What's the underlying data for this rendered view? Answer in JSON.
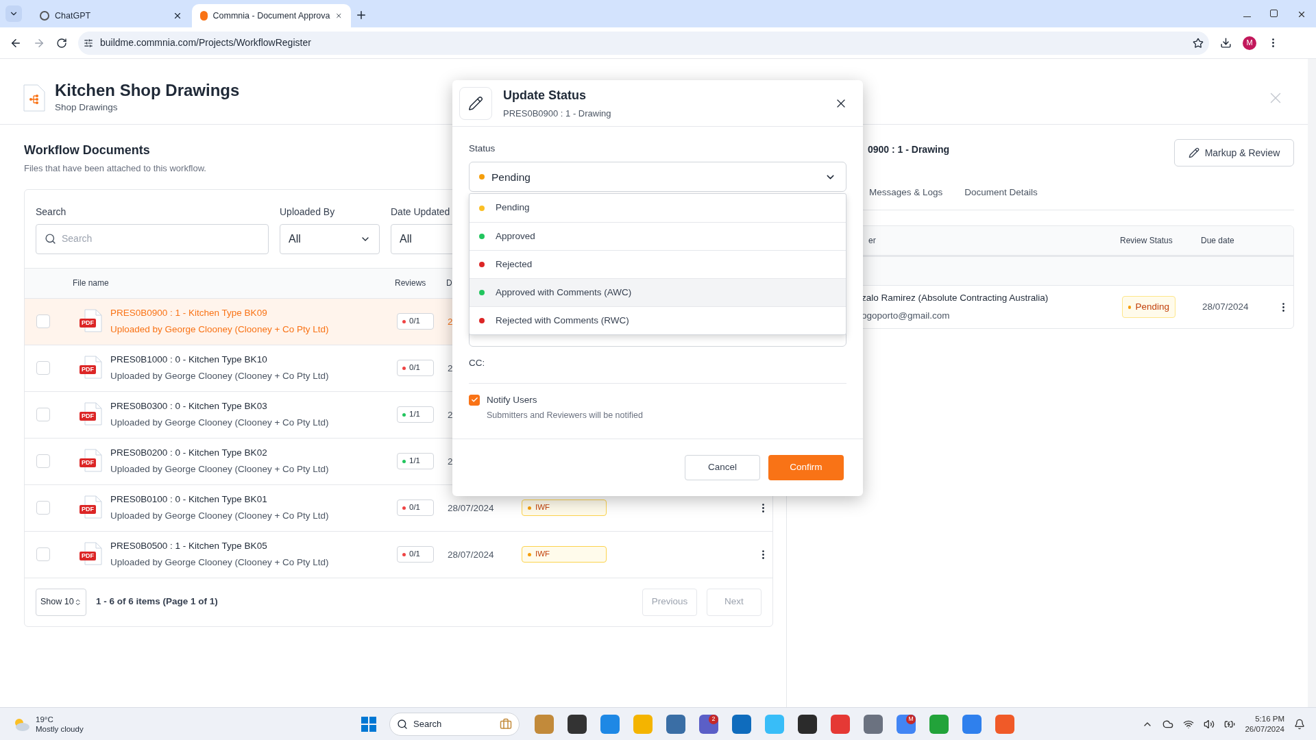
{
  "browser": {
    "tabs": [
      {
        "title": "ChatGPT",
        "selected": false
      },
      {
        "title": "Commnia - Document Approva",
        "selected": true
      }
    ],
    "url": "buildme.commnia.com/Projects/WorkflowRegister",
    "profile": "M"
  },
  "header": {
    "title": "Kitchen Shop Drawings",
    "subtitle": "Shop Drawings"
  },
  "documents": {
    "title": "Workflow Documents",
    "subtitle": "Files that have been attached to this workflow.",
    "filters": {
      "search_label": "Search",
      "search_placeholder": "Search",
      "uploaded_by_label": "Uploaded By",
      "uploaded_by_value": "All",
      "date_updated_label": "Date Updated",
      "date_updated_value": "All"
    },
    "columns": [
      "File name",
      "Reviews",
      "D"
    ],
    "rows": [
      {
        "name": "PRES0B0900 : 1 - Kitchen Type BK09",
        "uploader": "Uploaded by George Clooney (Clooney + Co Pty Ltd)",
        "file_type": "PDF",
        "reviews": "0/1",
        "color": "#ef4444",
        "date": "2",
        "selected": true,
        "checked": false
      },
      {
        "name": "PRES0B1000 : 0 - Kitchen Type BK10",
        "uploader": "Uploaded by George Clooney (Clooney + Co Pty Ltd)",
        "file_type": "PDF",
        "reviews": "0/1",
        "color": "#ef4444",
        "date": "2",
        "selected": false,
        "checked": false
      },
      {
        "name": "PRES0B0300 : 0 - Kitchen Type BK03",
        "uploader": "Uploaded by George Clooney (Clooney + Co Pty Ltd)",
        "file_type": "PDF",
        "reviews": "1/1",
        "color": "#22c55e",
        "date": "2",
        "selected": false,
        "checked": false
      },
      {
        "name": "PRES0B0200 : 0 - Kitchen Type BK02",
        "uploader": "Uploaded by George Clooney (Clooney + Co Pty Ltd)",
        "file_type": "PDF",
        "reviews": "1/1",
        "color": "#22c55e",
        "date": "2",
        "selected": false,
        "checked": false
      },
      {
        "name": "PRES0B0100 : 0 - Kitchen Type BK01",
        "uploader": "Uploaded by George Clooney (Clooney + Co Pty Ltd)",
        "file_type": "PDF",
        "reviews": "0/1",
        "color": "#ef4444",
        "date": "28/07/2024",
        "status": "IWF",
        "selected": false,
        "checked": false
      },
      {
        "name": "PRES0B0500 : 1 - Kitchen Type BK05",
        "uploader": "Uploaded by George Clooney (Clooney + Co Pty Ltd)",
        "file_type": "PDF",
        "reviews": "0/1",
        "color": "#ef4444",
        "date": "28/07/2024",
        "status": "IWF",
        "selected": false,
        "checked": false
      }
    ],
    "footer": {
      "page_size": "Show 10",
      "summary": "1 - 6 of 6 items (Page 1 of 1)",
      "previous": "Previous",
      "next": "Next"
    }
  },
  "details": {
    "document_title": "0900 : 1 - Drawing",
    "markup_button": "Markup & Review",
    "tabs": [
      {
        "label": "Messages & Logs",
        "selected": false
      },
      {
        "label": "Document Details",
        "selected": false
      }
    ],
    "columns": [
      "er",
      "Review Status",
      "Due date"
    ],
    "rows": [
      {
        "name": "zalo Ramirez (Absolute Contracting Australia)",
        "email": "ogoporto@gmail.com",
        "status": "Pending",
        "due": "28/07/2024"
      }
    ]
  },
  "modal": {
    "title": "Update Status",
    "subtitle": "PRES0B0900 : 1 - Drawing",
    "status_label": "Status",
    "status": {
      "label": "Pending",
      "color": "#f59e0b"
    },
    "options": [
      {
        "label": "Pending",
        "color": "#fbbf24",
        "highlighted": false
      },
      {
        "label": "Approved",
        "color": "#22c55e",
        "highlighted": false
      },
      {
        "label": "Rejected",
        "color": "#dc2626",
        "highlighted": false
      },
      {
        "label": "Approved with Comments (AWC)",
        "color": "#22c55e",
        "highlighted": true
      },
      {
        "label": "Rejected with Comments (RWC)",
        "color": "#dc2626",
        "highlighted": false
      }
    ],
    "cc_label": "CC:",
    "notify": {
      "label": "Notify Users",
      "description": "Submitters and Reviewers will be notified",
      "checked": true
    },
    "cancel": "Cancel",
    "confirm": "Confirm"
  },
  "taskbar": {
    "temperature": "19°C",
    "weather": "Mostly cloudy",
    "search": "Search",
    "apps": [
      {
        "color": "#c28a3a"
      },
      {
        "color": "#333333"
      },
      {
        "color": "#1e88e5"
      },
      {
        "color": "#f4b400"
      },
      {
        "color": "#3a6ea5"
      },
      {
        "color": "#5b5fc7",
        "badge": "2"
      },
      {
        "color": "#0f6cbd"
      },
      {
        "color": "#38bdf8"
      },
      {
        "color": "#2b2b2b"
      },
      {
        "color": "#e53935"
      },
      {
        "color": "#6b7280"
      },
      {
        "color": "#4285f4",
        "badge": "M"
      },
      {
        "color": "#22a33a"
      },
      {
        "color": "#2f80ed"
      },
      {
        "color": "#f05a28"
      }
    ],
    "time": "5:16 PM",
    "date": "26/07/2024"
  }
}
